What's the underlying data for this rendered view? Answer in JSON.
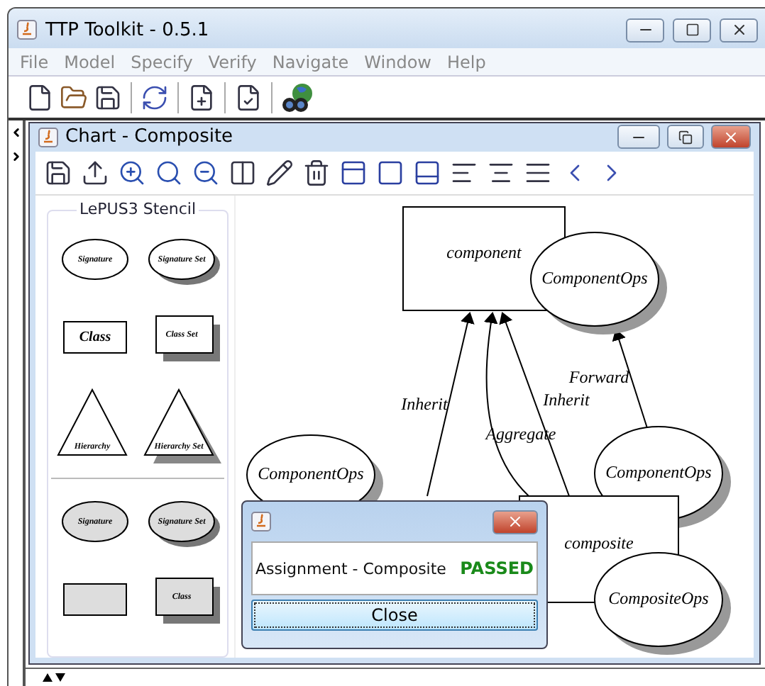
{
  "window": {
    "title": "TTP Toolkit - 0.5.1"
  },
  "menu": [
    "File",
    "Model",
    "Specify",
    "Verify",
    "Navigate",
    "Window",
    "Help"
  ],
  "chart_window": {
    "title": "Chart - Composite"
  },
  "stencil": {
    "title": "LePUS3 Stencil",
    "groups": [
      {
        "filled": false,
        "items": [
          {
            "kind": "ellipse",
            "label": "Signature",
            "set": false
          },
          {
            "kind": "ellipse",
            "label": "Signature Set",
            "set": true
          },
          {
            "kind": "rect",
            "label": "Class",
            "set": false
          },
          {
            "kind": "rect",
            "label": "Class Set",
            "set": true
          },
          {
            "kind": "triangle",
            "label": "Hierarchy",
            "set": false
          },
          {
            "kind": "triangle",
            "label": "Hierarchy Set",
            "set": true
          }
        ]
      },
      {
        "filled": true,
        "items": [
          {
            "kind": "ellipse",
            "label": "Signature",
            "set": false
          },
          {
            "kind": "ellipse",
            "label": "Signature Set",
            "set": true
          },
          {
            "kind": "rect",
            "set": false
          },
          {
            "kind": "rect",
            "label": "Class",
            "set": true
          }
        ]
      }
    ]
  },
  "diagram": {
    "nodes": [
      {
        "kind": "class",
        "label": "component"
      },
      {
        "kind": "signature",
        "label": "ComponentOps"
      },
      {
        "kind": "signature",
        "label": "ComponentOps"
      },
      {
        "kind": "signature",
        "label": "ComponentOps"
      },
      {
        "kind": "class",
        "label": "composite"
      },
      {
        "kind": "signature",
        "label": "CompositeOps"
      }
    ],
    "edges": [
      {
        "label": "Inherit"
      },
      {
        "label": "Aggregate"
      },
      {
        "label": "Inherit"
      },
      {
        "label": "Forward"
      }
    ]
  },
  "dialog": {
    "message": "Assignment - Composite",
    "result": "PASSED",
    "button": "Close"
  }
}
